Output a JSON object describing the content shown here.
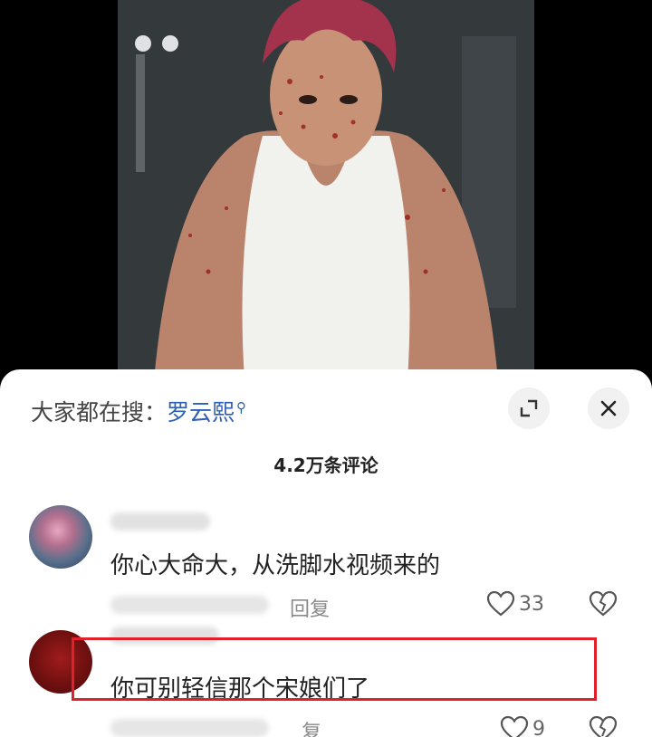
{
  "colors": {
    "accent_blue": "#2e5fb4",
    "highlight_red": "#e0202a",
    "sheet_bg": "#ffffff"
  },
  "search": {
    "prefix": "大家都在搜：",
    "term": "罗云熙",
    "icon": "search-icon"
  },
  "header": {
    "comment_count": "4.2万条评论"
  },
  "comments": [
    {
      "text": "你心大命大，从洗脚水视频来的",
      "reply_label": "回复",
      "likes": "33"
    },
    {
      "text": "你可别轻信那个宋娘们了",
      "reply_label": "复",
      "likes": "9"
    }
  ]
}
